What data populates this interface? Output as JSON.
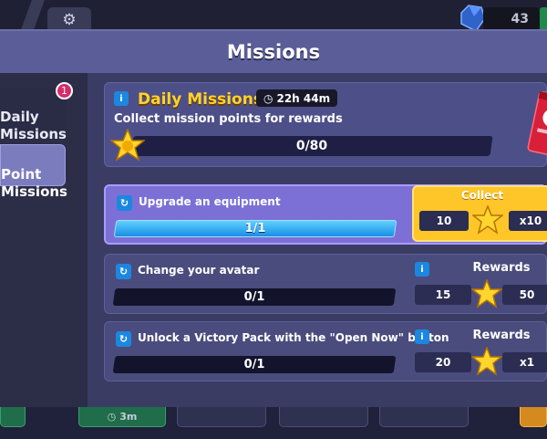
{
  "topbar": {
    "gem_count": "43"
  },
  "modal": {
    "title": "Missions"
  },
  "tabs": [
    {
      "label": "Daily\nMissions",
      "badge": "1"
    },
    {
      "label": "Point\nMissions"
    }
  ],
  "daily": {
    "title": "Daily Missions",
    "timer": "22h 44m",
    "subtitle": "Collect mission points for rewards",
    "progress_text": "0/80",
    "progress": 0
  },
  "missions": [
    {
      "label": "Upgrade an equipment",
      "progress_text": "1/1",
      "progress": 1,
      "status": "Collect",
      "points": "10",
      "multiplier": "x10"
    },
    {
      "label": "Change your avatar",
      "progress_text": "0/1",
      "progress": 0,
      "status": "Rewards",
      "points": "15",
      "multiplier": "50"
    },
    {
      "label": "Unlock a Victory Pack with the \"Open Now\" button",
      "progress_text": "0/1",
      "progress": 0,
      "status": "Rewards",
      "points": "20",
      "multiplier": "x1"
    }
  ],
  "bottom": {
    "timer": "3m"
  },
  "colors": {
    "accent_yellow": "#ffd32a",
    "progress_blue": "#1a8fe4",
    "badge_pink": "#d52c6b",
    "panel_purple": "#4b4d86"
  }
}
